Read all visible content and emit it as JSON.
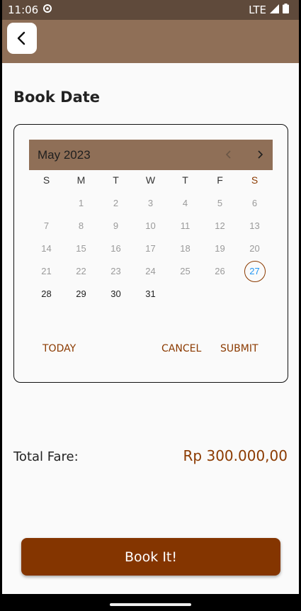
{
  "status": {
    "time": "11:06",
    "network": "LTE"
  },
  "page": {
    "title": "Book Date"
  },
  "calendar": {
    "month_label": "May 2023",
    "weekdays": [
      "S",
      "M",
      "T",
      "W",
      "T",
      "F",
      "S"
    ],
    "weeks": [
      [
        "",
        "1",
        "2",
        "3",
        "4",
        "5",
        "6"
      ],
      [
        "7",
        "8",
        "9",
        "10",
        "11",
        "12",
        "13"
      ],
      [
        "14",
        "15",
        "16",
        "17",
        "18",
        "19",
        "20"
      ],
      [
        "21",
        "22",
        "23",
        "24",
        "25",
        "26",
        "27"
      ],
      [
        "28",
        "29",
        "30",
        "31",
        "",
        "",
        ""
      ]
    ],
    "selected": "27",
    "actions": {
      "today": "TODAY",
      "cancel": "CANCEL",
      "submit": "SUBMIT"
    }
  },
  "fare": {
    "label": "Total Fare:",
    "value": "Rp 300.000,00"
  },
  "book_button": "Book It!",
  "colors": {
    "accent": "#8b3a00",
    "header": "#8f6f57",
    "statusbar": "#5f4a3b",
    "selected_text": "#2196f3"
  }
}
